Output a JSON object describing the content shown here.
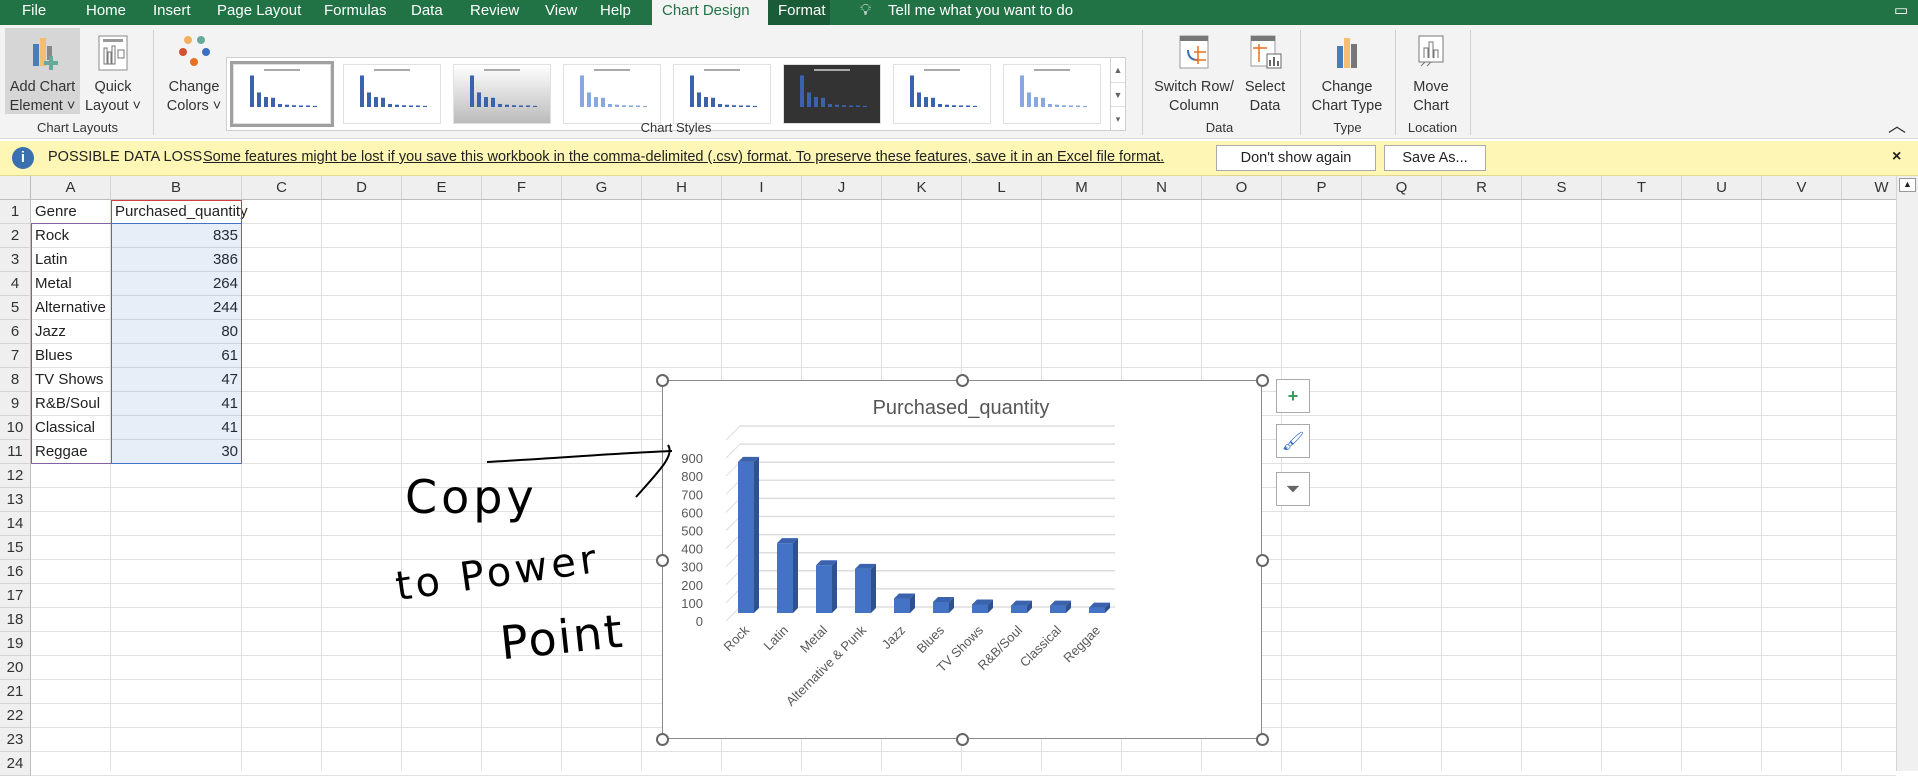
{
  "tabs": [
    {
      "label": "File"
    },
    {
      "label": "Home"
    },
    {
      "label": "Insert"
    },
    {
      "label": "Page Layout"
    },
    {
      "label": "Formulas"
    },
    {
      "label": "Data"
    },
    {
      "label": "Review"
    },
    {
      "label": "View"
    },
    {
      "label": "Help"
    },
    {
      "label": "Chart Design"
    },
    {
      "label": "Format"
    }
  ],
  "tell_me": "Tell me what you want to do",
  "ribbon": {
    "add_chart_element": [
      "Add Chart",
      "Element ˅"
    ],
    "quick_layout": [
      "Quick",
      "Layout ˅"
    ],
    "change_colors": [
      "Change",
      "Colors ˅"
    ],
    "switch_row_column": [
      "Switch Row/",
      "Column"
    ],
    "select_data": [
      "Select",
      "Data"
    ],
    "change_chart_type": [
      "Change",
      "Chart Type"
    ],
    "move_chart": [
      "Move",
      "Chart"
    ],
    "groups": {
      "chart_layouts": "Chart Layouts",
      "chart_styles": "Chart Styles",
      "data": "Data",
      "type": "Type",
      "location": "Location"
    },
    "style_count": 8
  },
  "infobar": {
    "title": "POSSIBLE DATA LOSS",
    "message": "Some features might be lost if you save this workbook in the comma-delimited (.csv) format. To preserve these features, save it in an Excel file format.",
    "dont_show": "Don't show again",
    "save_as": "Save As...",
    "close": "×"
  },
  "columns": [
    "A",
    "B",
    "C",
    "D",
    "E",
    "F",
    "G",
    "H",
    "I",
    "J",
    "K",
    "L",
    "M",
    "N",
    "O",
    "P",
    "Q",
    "R",
    "S",
    "T",
    "U",
    "V",
    "W"
  ],
  "rows": [
    "1",
    "2",
    "3",
    "4",
    "5",
    "6",
    "7",
    "8",
    "9",
    "10",
    "11",
    "12",
    "13",
    "14",
    "15",
    "16",
    "17",
    "18",
    "19",
    "20",
    "21",
    "22",
    "23",
    "24"
  ],
  "sheet": {
    "headers": [
      "Genre",
      "Purchased_quantity"
    ],
    "data": [
      [
        "Rock",
        "835"
      ],
      [
        "Latin",
        "386"
      ],
      [
        "Metal",
        "264"
      ],
      [
        "Alternative",
        "244"
      ],
      [
        "Jazz",
        "80"
      ],
      [
        "Blues",
        "61"
      ],
      [
        "TV Shows",
        "47"
      ],
      [
        "R&B/Soul",
        "41"
      ],
      [
        "Classical",
        "41"
      ],
      [
        "Reggae",
        "30"
      ]
    ]
  },
  "annotation": {
    "line1": "Copy",
    "line2": "to Power",
    "line3": "Point"
  },
  "colors": {
    "accent": "#217346",
    "bar": "#4472c4",
    "bar_side": "#2f528f",
    "bar_top": "#3a62ad"
  },
  "chart_data": {
    "type": "bar",
    "style": "3d-column",
    "title": "Purchased_quantity",
    "categories": [
      "Rock",
      "Latin",
      "Metal",
      "Alternative & Punk",
      "Jazz",
      "Blues",
      "TV Shows",
      "R&B/Soul",
      "Classical",
      "Reggae"
    ],
    "values": [
      835,
      386,
      264,
      244,
      80,
      61,
      47,
      41,
      41,
      30
    ],
    "ylim": [
      0,
      1000
    ],
    "yticks": [
      "0",
      "100",
      "200",
      "300",
      "400",
      "500",
      "600",
      "700",
      "800",
      "900"
    ],
    "grid": true,
    "legend": "none"
  }
}
